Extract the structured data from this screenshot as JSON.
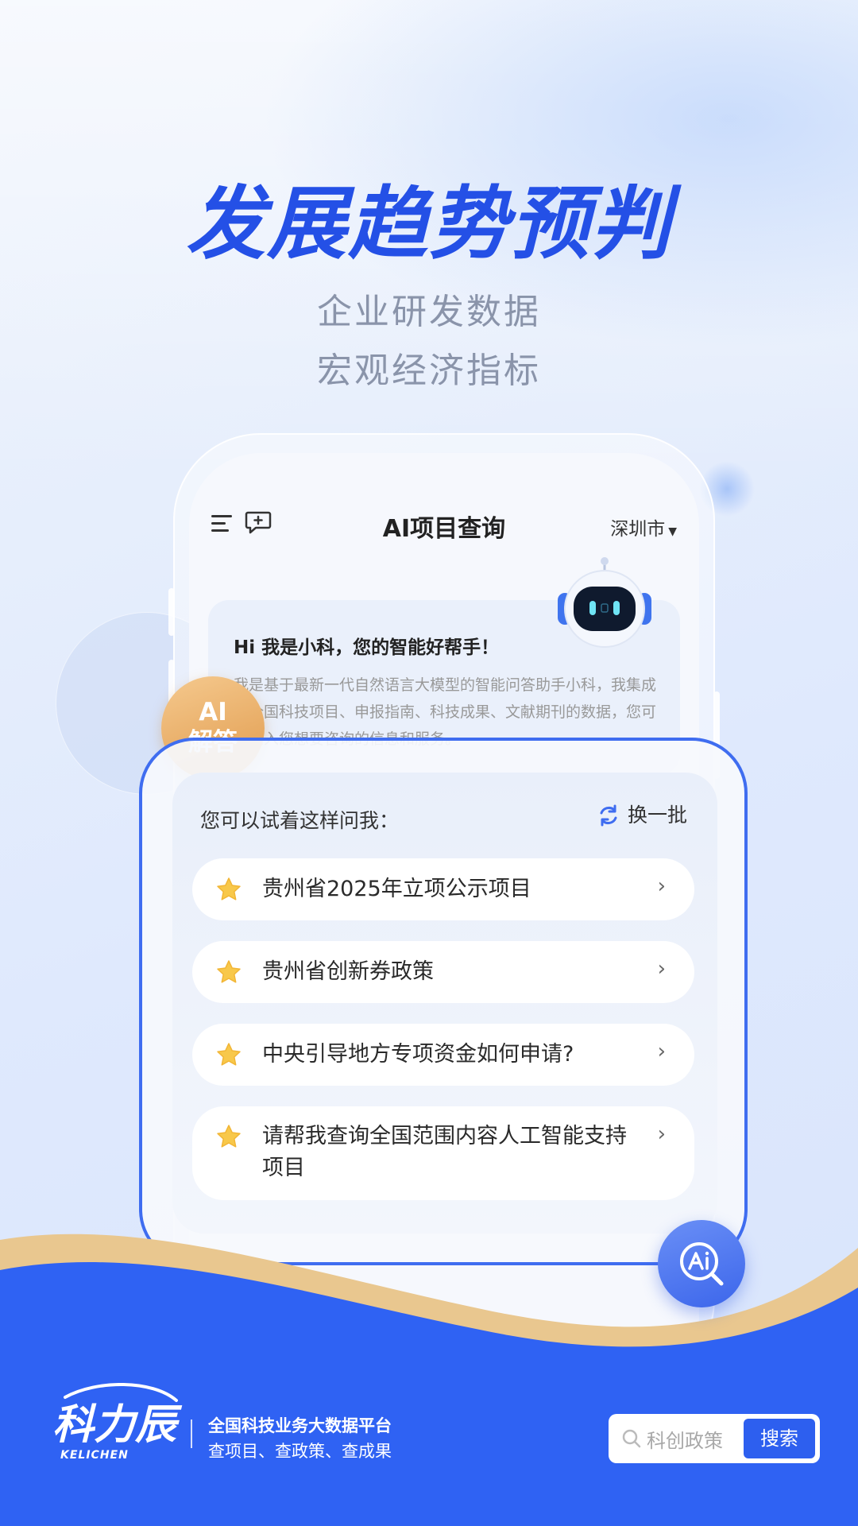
{
  "headline": "发展趋势预判",
  "subtitles": [
    "企业研发数据",
    "宏观经济指标"
  ],
  "phone": {
    "title": "AI项目查询",
    "city": "深圳市",
    "greeting_title": "Hi 我是小科，您的智能好帮手！",
    "greeting_body": "我是基于最新一代自然语言大模型的智能问答助手小科，我集成了全国科技项目、申报指南、科技成果、文献期刊的数据，您可以输入您想要咨询的信息和服务。"
  },
  "badge": {
    "line1": "AI",
    "line2": "解答"
  },
  "questions_card": {
    "hint": "您可以试着这样问我：",
    "refresh_label": "换一批",
    "items": [
      {
        "text": "贵州省2025年立项公示项目"
      },
      {
        "text": "贵州省创新券政策"
      },
      {
        "text": "中央引导地方专项资金如何申请?"
      },
      {
        "text": "请帮我查询全国范围内容人工智能支持项目"
      }
    ]
  },
  "footer": {
    "logo_text": "科力辰",
    "logo_sub": "KELICHEN",
    "tagline1": "全国科技业务大数据平台",
    "tagline2": "查项目、查政策、查成果",
    "search_placeholder": "科创政策",
    "search_button": "搜索"
  },
  "colors": {
    "primary": "#2d5fef",
    "headline": "#2450e6",
    "gold": "#e8b884"
  },
  "icons": {
    "menu": "menu-icon",
    "chat": "chat-add-icon",
    "robot": "robot-icon",
    "refresh": "refresh-icon",
    "star": "star-icon",
    "chevron": "chevron-right-icon",
    "fab": "ai-search-icon",
    "search": "search-icon"
  }
}
